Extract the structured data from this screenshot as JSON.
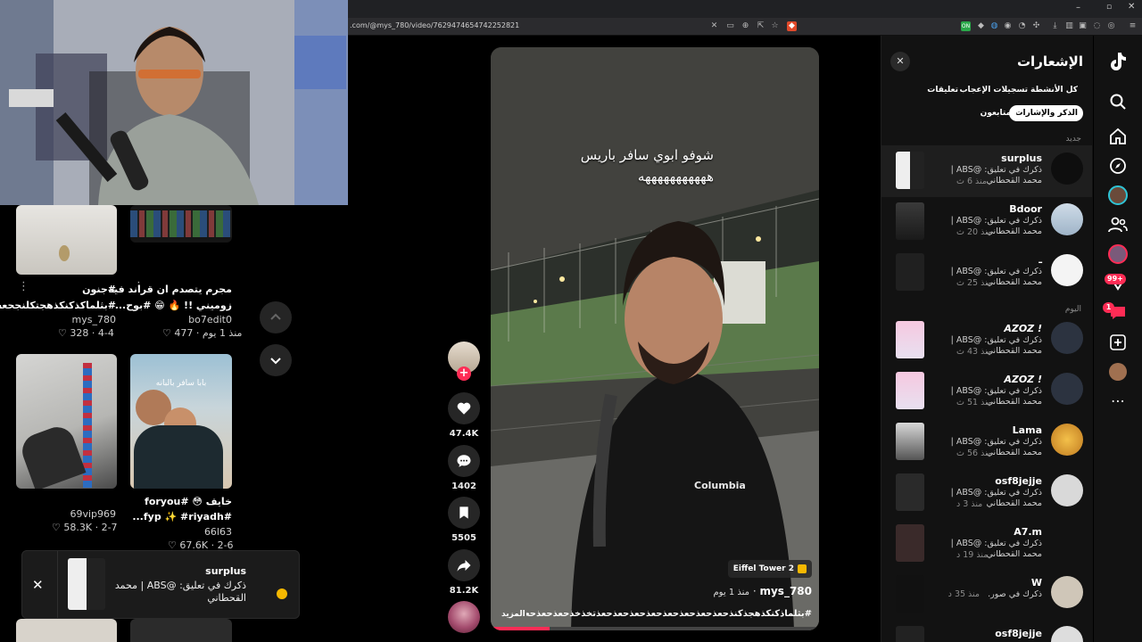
{
  "browser": {
    "url": ".com/@mys_780/video/7629474654742252821",
    "window_controls": [
      "minimize-icon",
      "restore-icon",
      "close-icon"
    ]
  },
  "feed": {
    "items": [
      {
        "caption_line1": "#جنون",
        "caption_line2": "#بثلماكذكنكذهجتكلنجحعه...",
        "author": "mys_780",
        "likes": "328",
        "date": "4-4"
      },
      {
        "caption_line1": "مجرم يتصدم ان قراند فيه",
        "caption_line2": "زوميني !! 🔥 😁 #بوح...",
        "author": "bo7edit0",
        "likes": "477",
        "date": "منذ 1 يوم"
      },
      {
        "caption_line1": "",
        "caption_line2": "",
        "author": "69vip969",
        "likes": "58.3K",
        "date": "2-7"
      },
      {
        "caption_line1": "خايف 😳 #foryou",
        "caption_line2": "#fyp ✨ #riyadh...",
        "author": "66l63",
        "likes": "67.6K",
        "date": "2-6"
      }
    ],
    "thumb_overlay": "بابا سافر بالبانه"
  },
  "video": {
    "overlay_line1": "شوفو ابوي سافر باريس",
    "overlay_line2": "هههههههههههه",
    "location_tag": "Eiffel Tower 2",
    "author": "mys_780",
    "posted": "منذ 1 يوم",
    "caption": "#بثلماذكنكذهجذكنذحعذحعذحعذحعذحعذحعذحعذحعذتخذخذحعذحعذحعه...",
    "more_label": "المزيد",
    "shirt_brand": "Columbia"
  },
  "actions": {
    "likes": "47.4K",
    "comments": "1402",
    "saves": "5505",
    "shares": "81.2K"
  },
  "notifications": {
    "title": "الإشعارات",
    "tabs": [
      "كل الأنشطة",
      "تسجيلات الإعجاب",
      "تعليقات",
      "الذكر والإشارات",
      "المتابعون"
    ],
    "section_new": "جديد",
    "section_today": "اليوم",
    "items": [
      {
        "name": "surplus",
        "text": "ذكرك في تعليق: @ABS | محمد القحطاني",
        "time": "منذ 6 ث"
      },
      {
        "name": "Bdoor",
        "text": "ذكرك في تعليق: @ABS | محمد القحطاني",
        "time": "منذ 20 ث"
      },
      {
        "name": "ـ",
        "text": "ذكرك في تعليق: @ABS | محمد القحطاني",
        "time": "منذ 25 ث"
      },
      {
        "name": "AZOZ !",
        "text": "ذكرك في تعليق: @ABS | محمد القحطاني",
        "time": "منذ 43 ث"
      },
      {
        "name": "AZOZ !",
        "text": "ذكرك في تعليق: @ABS | محمد القحطاني",
        "time": "منذ 51 ث"
      },
      {
        "name": "Lama",
        "text": "ذكرك في تعليق: @ABS | محمد القحطاني",
        "time": "منذ 56 ث"
      },
      {
        "name": "osf8jejje",
        "text": "ذكرك في تعليق: @ABS | محمد القحطاني",
        "time": "منذ 3 د"
      },
      {
        "name": "A7.m",
        "text": "ذكرك في تعليق: @ABS | محمد القحطاني",
        "time": "منذ 19 د"
      },
      {
        "name": "W",
        "text": "ذكرك في صور.",
        "time": "منذ 35 د"
      },
      {
        "name": "osf8jejje",
        "text": "",
        "time": ""
      }
    ]
  },
  "rail": {
    "badge_messages": "99+",
    "badge_inbox": "1"
  },
  "toast": {
    "name": "surplus",
    "text": "ذكرك في تعليق: @ABS | محمد القحطاني"
  },
  "colors": {
    "accent": "#fe2c55",
    "panel": "#121212"
  }
}
